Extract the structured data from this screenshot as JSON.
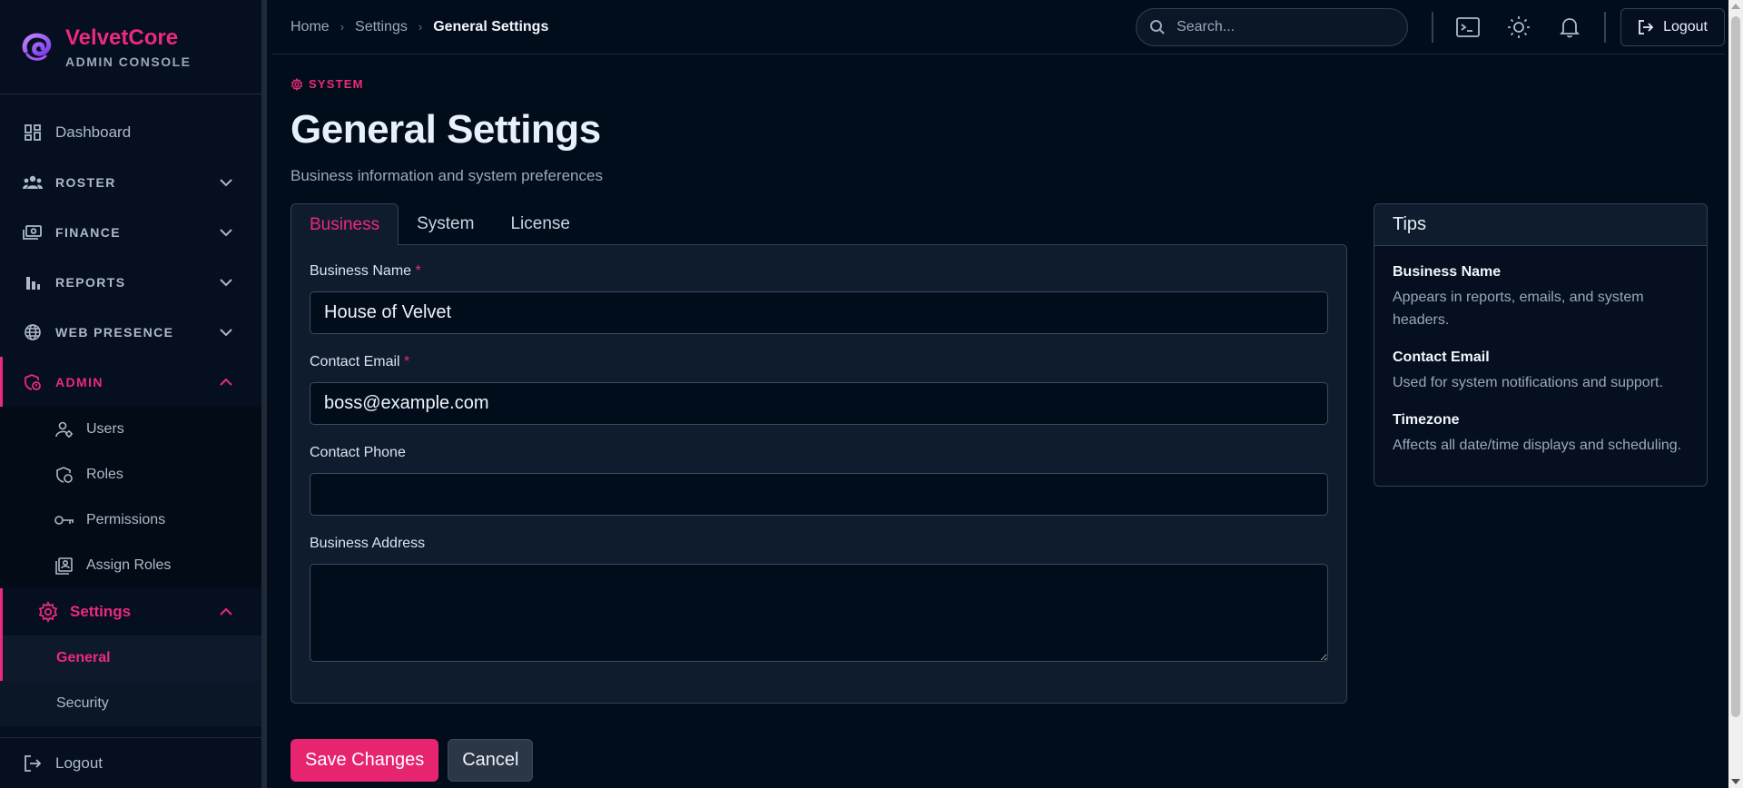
{
  "brand": {
    "name": "VelvetCore",
    "subtitle": "ADMIN CONSOLE"
  },
  "colors": {
    "accent": "#ec2a7b",
    "background": "#020d1c",
    "panel": "#0f1c2e"
  },
  "sidebar": {
    "items": [
      {
        "label": "Dashboard",
        "icon": "dashboard-icon"
      },
      {
        "label": "ROSTER",
        "icon": "users-group-icon"
      },
      {
        "label": "FINANCE",
        "icon": "money-icon"
      },
      {
        "label": "REPORTS",
        "icon": "bar-chart-icon"
      },
      {
        "label": "WEB PRESENCE",
        "icon": "globe-icon"
      },
      {
        "label": "ADMIN",
        "icon": "shield-icon"
      }
    ],
    "admin_sub": [
      {
        "label": "Users",
        "icon": "user-gear-icon"
      },
      {
        "label": "Roles",
        "icon": "shield-lock-icon"
      },
      {
        "label": "Permissions",
        "icon": "key-icon"
      },
      {
        "label": "Assign Roles",
        "icon": "id-card-icon"
      }
    ],
    "settings": {
      "label": "Settings",
      "items": [
        {
          "label": "General"
        },
        {
          "label": "Security"
        }
      ]
    },
    "logout_label": "Logout"
  },
  "topbar": {
    "breadcrumbs": [
      "Home",
      "Settings",
      "General Settings"
    ],
    "search_placeholder": "Search...",
    "logout_label": "Logout"
  },
  "page": {
    "eyebrow": "SYSTEM",
    "title": "General Settings",
    "subtitle": "Business information and system preferences"
  },
  "tabs": [
    "Business",
    "System",
    "License"
  ],
  "form": {
    "business_name": {
      "label": "Business Name",
      "required_mark": "*",
      "value": "House of Velvet"
    },
    "contact_email": {
      "label": "Contact Email",
      "required_mark": "*",
      "value": "boss@example.com"
    },
    "contact_phone": {
      "label": "Contact Phone",
      "value": ""
    },
    "business_address": {
      "label": "Business Address",
      "value": ""
    }
  },
  "actions": {
    "save": "Save Changes",
    "cancel": "Cancel"
  },
  "tips": {
    "title": "Tips",
    "items": [
      {
        "title": "Business Name",
        "text": "Appears in reports, emails, and system headers."
      },
      {
        "title": "Contact Email",
        "text": "Used for system notifications and support."
      },
      {
        "title": "Timezone",
        "text": "Affects all date/time displays and scheduling."
      }
    ]
  }
}
